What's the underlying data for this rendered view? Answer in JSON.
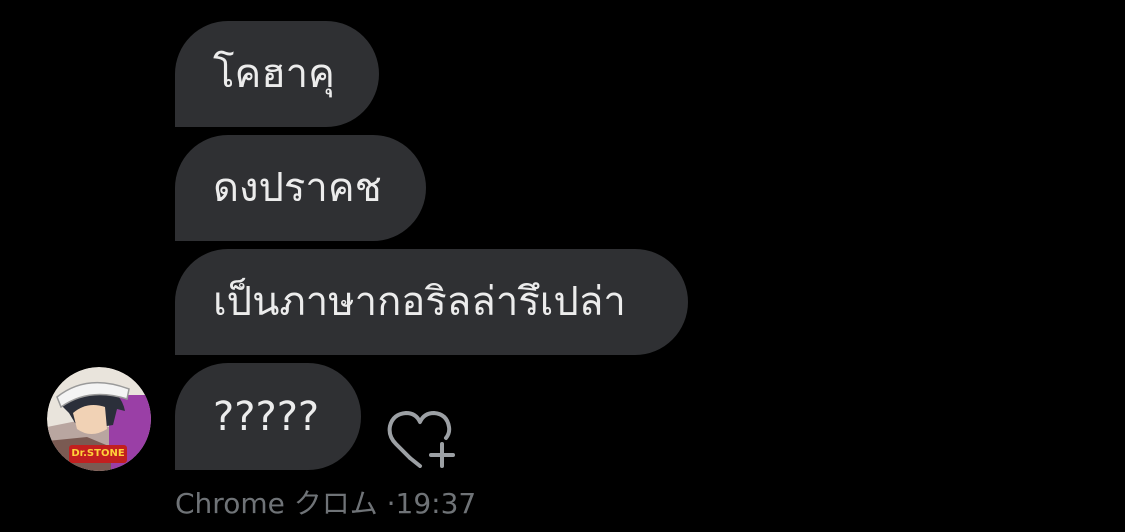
{
  "messages": [
    {
      "text": "โคฮาคุ"
    },
    {
      "text": "ดงปราคช"
    },
    {
      "text": "เป็นภาษากอริลล่ารึเปล่า"
    },
    {
      "text": "?????"
    }
  ],
  "sender": {
    "name": "Chrome クロム",
    "time": "·19:37",
    "avatar_logo": "Dr.STONE"
  },
  "reaction_icon": "heart-plus-icon",
  "colors": {
    "background": "#000000",
    "bubble": "#2f3033",
    "bubble_text": "#ececec",
    "meta_text": "#6f7377"
  }
}
